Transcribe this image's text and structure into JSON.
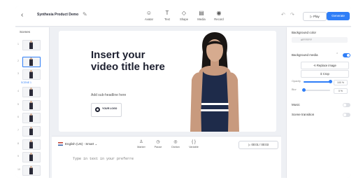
{
  "header": {
    "back_icon": "chevron-left-icon",
    "project_title": "Synthesia Product Demo",
    "edit_icon": "pencil-icon",
    "tools": [
      {
        "label": "Avatar",
        "icon": "avatar-icon",
        "glyph": "☺"
      },
      {
        "label": "Text",
        "icon": "text-icon",
        "glyph": "T"
      },
      {
        "label": "Shape",
        "icon": "shape-icon",
        "glyph": "◇"
      },
      {
        "label": "Media",
        "icon": "media-icon",
        "glyph": "▤"
      },
      {
        "label": "Record",
        "icon": "record-icon",
        "glyph": "◉"
      }
    ],
    "undo_icon": "undo-icon",
    "redo_icon": "redo-icon",
    "play_label": "Play",
    "generate_label": "Generate",
    "accent_color": "#2f7ef7"
  },
  "scenes": {
    "title": "Scenes",
    "selected_label": "SCENE 1",
    "count": 10
  },
  "canvas": {
    "title": "Insert your video title here",
    "subheadline": "Add sub-headline here",
    "logo_text": "YOUR LOGO"
  },
  "script": {
    "language": "English (US) - Smart",
    "tools": [
      {
        "label": "Marker",
        "icon": "marker-icon",
        "glyph": "♙"
      },
      {
        "label": "Pause",
        "icon": "pause-icon",
        "glyph": "◷"
      },
      {
        "label": "Diction",
        "icon": "diction-icon",
        "glyph": "◎"
      },
      {
        "label": "Variable",
        "icon": "variable-icon",
        "glyph": "{ }"
      }
    ],
    "timecode": "00:01 / 00:03",
    "placeholder": "Type in text in your preferre"
  },
  "right_panel": {
    "background_color_label": "Background color",
    "background_color_value": "#FFFFFF",
    "background_media_label": "Background media",
    "background_media_enabled": true,
    "replace_image_label": "Replace image",
    "crop_label": "Crop",
    "opacity_label": "Opacity",
    "opacity_value": "100 %",
    "opacity_level": 1.0,
    "blur_label": "Blur",
    "blur_value": "0 %",
    "blur_level": 0.0,
    "music_label": "Music",
    "music_enabled": false,
    "scene_transition_label": "Scene transition",
    "scene_transition_enabled": false
  }
}
